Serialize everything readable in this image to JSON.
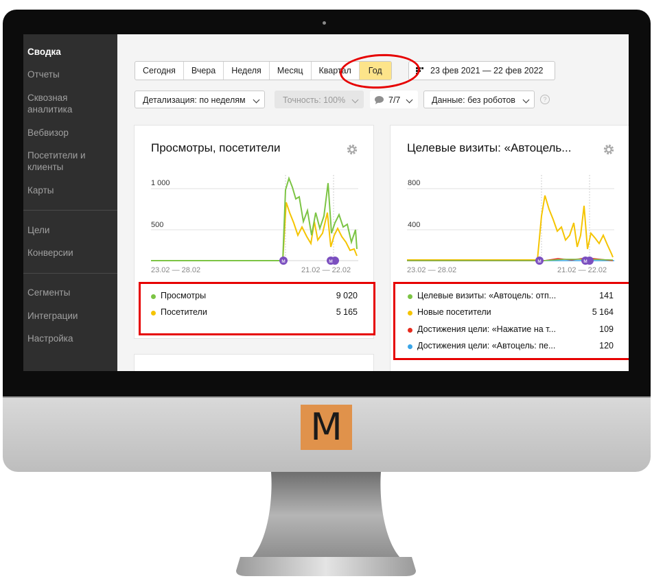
{
  "sidebar": {
    "items": [
      {
        "label": "Сводка",
        "active": true
      },
      {
        "label": "Отчеты"
      },
      {
        "label": "Сквозная аналитика"
      },
      {
        "label": "Вебвизор"
      },
      {
        "label": "Посетители и клиенты"
      },
      {
        "label": "Карты"
      },
      {
        "label": "Цели"
      },
      {
        "label": "Конверсии"
      },
      {
        "label": "Сегменты"
      },
      {
        "label": "Интеграции"
      },
      {
        "label": "Настройка"
      }
    ]
  },
  "period": {
    "options": [
      "Сегодня",
      "Вчера",
      "Неделя",
      "Месяц",
      "Квартал",
      "Год"
    ],
    "selected": "Год",
    "date_range": "23 фев 2021 — 22 фев 2022"
  },
  "filters": {
    "detail": "Детализация: по неделям",
    "accuracy": "Точность: 100%",
    "comments": "7/7",
    "data": "Данные: без роботов",
    "help": "?"
  },
  "widgets": [
    {
      "title": "Просмотры, посетители",
      "y_ticks": [
        "1 000",
        "500"
      ],
      "x_start": "23.02 — 28.02",
      "x_end": "21.02 — 22.02",
      "marker": "м",
      "legend": [
        {
          "label": "Просмотры",
          "value": "9 020",
          "color": "#7cc444"
        },
        {
          "label": "Посетители",
          "value": "5 165",
          "color": "#f5c400"
        }
      ]
    },
    {
      "title": "Целевые визиты: «Автоцель...",
      "y_ticks": [
        "800",
        "400"
      ],
      "x_start": "23.02 — 28.02",
      "x_end": "21.02 — 22.02",
      "marker": "м",
      "legend": [
        {
          "label": "Целевые визиты: «Автоцель: отп...",
          "value": "141",
          "color": "#7cc444"
        },
        {
          "label": "Новые посетители",
          "value": "5 164",
          "color": "#f5c400"
        },
        {
          "label": "Достижения цели: «Нажатие на т...",
          "value": "109",
          "color": "#e62b1e"
        },
        {
          "label": "Достижения цели: «Автоцель: пе...",
          "value": "120",
          "color": "#3aa5e8"
        }
      ]
    }
  ],
  "logo": {
    "letter": "M",
    "color": "#e0924b"
  },
  "colors": {
    "highlight": "#e60000",
    "selected": "#fde48a",
    "sidebar": "#2f2f2f"
  }
}
